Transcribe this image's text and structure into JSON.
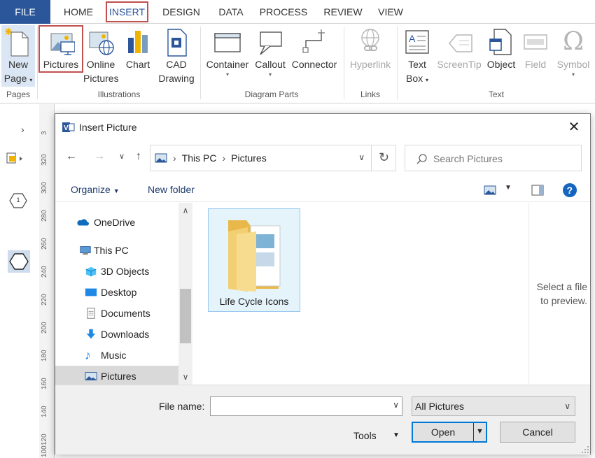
{
  "ribbon": {
    "tabs": [
      {
        "label": "FILE"
      },
      {
        "label": "HOME"
      },
      {
        "label": "INSERT"
      },
      {
        "label": "DESIGN"
      },
      {
        "label": "DATA"
      },
      {
        "label": "PROCESS"
      },
      {
        "label": "REVIEW"
      },
      {
        "label": "VIEW"
      }
    ],
    "buttons": {
      "new_page": {
        "line1": "New",
        "line2": "Page"
      },
      "pictures": {
        "line1": "Pictures"
      },
      "online_pictures": {
        "line1": "Online",
        "line2": "Pictures"
      },
      "chart": {
        "line1": "Chart"
      },
      "cad_drawing": {
        "line1": "CAD",
        "line2": "Drawing"
      },
      "container": {
        "line1": "Container"
      },
      "callout": {
        "line1": "Callout"
      },
      "connector": {
        "line1": "Connector"
      },
      "hyperlink": {
        "line1": "Hyperlink"
      },
      "text_box": {
        "line1": "Text",
        "line2": "Box"
      },
      "screentip": {
        "line1": "ScreenTip"
      },
      "object": {
        "line1": "Object"
      },
      "field": {
        "line1": "Field"
      },
      "symbol": {
        "line1": "Symbol"
      }
    },
    "groups": {
      "pages": "Pages",
      "illustrations": "Illustrations",
      "diagram_parts": "Diagram Parts",
      "links": "Links",
      "text": "Text"
    }
  },
  "ruler": {
    "ticks": [
      "3",
      "320",
      "300",
      "280",
      "260",
      "240",
      "220",
      "200",
      "180",
      "160",
      "140",
      "120",
      "100"
    ]
  },
  "left_pane": {
    "shape_label": "1"
  },
  "dialog": {
    "title": "Insert Picture",
    "close_glyph": "✕",
    "address": {
      "segments": [
        "This PC",
        "Pictures"
      ]
    },
    "search": {
      "placeholder": "Search Pictures"
    },
    "commands": {
      "organize": "Organize",
      "new_folder": "New folder"
    },
    "tree": [
      {
        "label": "OneDrive",
        "icon": "onedrive-icon"
      },
      {
        "label": "This PC",
        "icon": "computer-icon"
      },
      {
        "label": "3D Objects",
        "icon": "3d-objects-icon"
      },
      {
        "label": "Desktop",
        "icon": "desktop-icon"
      },
      {
        "label": "Documents",
        "icon": "documents-icon"
      },
      {
        "label": "Downloads",
        "icon": "downloads-icon"
      },
      {
        "label": "Music",
        "icon": "music-icon"
      },
      {
        "label": "Pictures",
        "icon": "pictures-icon",
        "selected": true
      }
    ],
    "files": [
      {
        "name": "Life Cycle Icons",
        "type": "folder"
      }
    ],
    "preview_text": "Select a file to preview.",
    "file_name_label": "File name:",
    "file_name_value": "",
    "file_type": "All Pictures",
    "tools_label": "Tools",
    "open_label": "Open",
    "cancel_label": "Cancel"
  },
  "colors": {
    "accent": "#2b579a",
    "highlight_border": "#c0504d",
    "focus": "#0078d7"
  }
}
